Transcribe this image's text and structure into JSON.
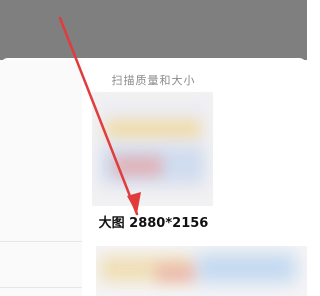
{
  "sheet": {
    "title": "扫描质量和大小"
  },
  "options": [
    {
      "label": "大图 2880*2156"
    }
  ],
  "colors": {
    "overlay": "#7f7f7f",
    "annotation_arrow": "#e23b3b"
  }
}
